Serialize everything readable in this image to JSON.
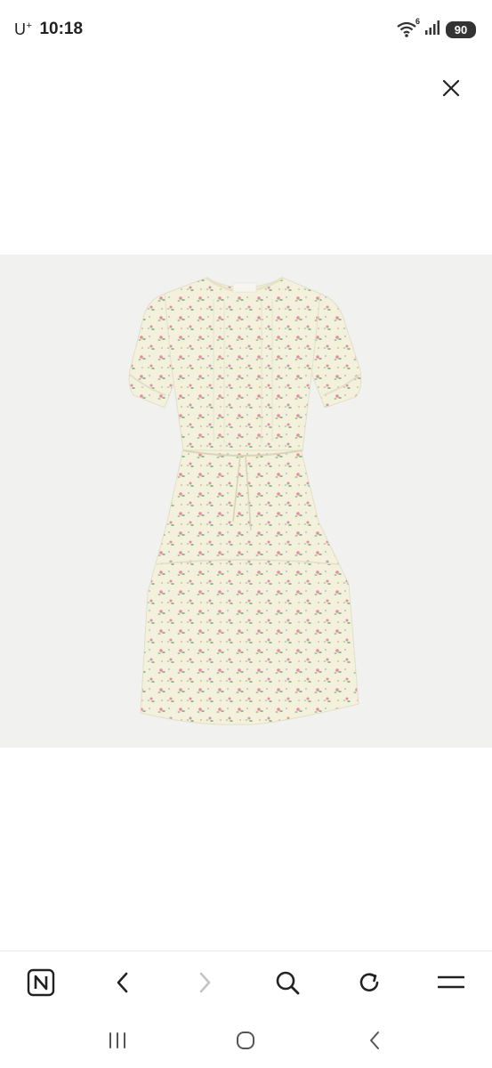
{
  "status_bar": {
    "carrier": "U",
    "carrier_sup": "+",
    "time": "10:18",
    "network_label": "6",
    "battery": "90"
  },
  "viewer": {
    "image_icon": "dress-image",
    "close_icon": "close-icon"
  },
  "toolbar": {
    "items": [
      "naver-home-icon",
      "back-icon",
      "forward-icon",
      "search-icon",
      "reload-icon",
      "menu-icon"
    ]
  },
  "system_nav": {
    "items": [
      "recent-apps-icon",
      "home-icon",
      "system-back-icon"
    ]
  },
  "colors": {
    "stage_bg": "#f1f1f0",
    "dress_base": "#f3f1dc",
    "flower_pink": "#e88aa0",
    "leaf_green": "#8fb58a"
  }
}
